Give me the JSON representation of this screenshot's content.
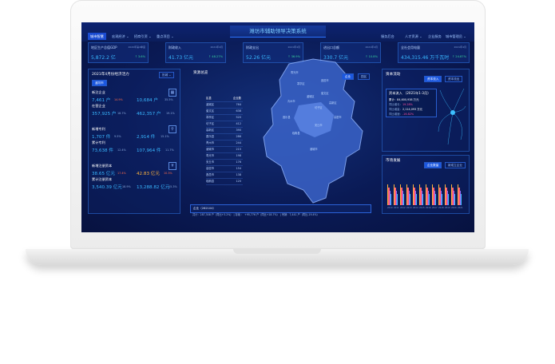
{
  "app": {
    "title": "潍坊市辅助领导决策系统"
  },
  "nav_left": [
    {
      "label": "城市智慧",
      "active": true
    },
    {
      "label": "宏观经济 ⌄",
      "active": false
    },
    {
      "label": "招商引资 ⌄",
      "active": false
    },
    {
      "label": "重点项目 ⌄",
      "active": false
    }
  ],
  "nav_right": [
    "服务后台",
    "人才资源 ⌄",
    "企业服务",
    "城市管理员 ⌄"
  ],
  "cards": [
    {
      "label": "地区生产总值GDP",
      "date": "2020年第4季度",
      "value": "5,872.2 亿",
      "change": "↑ 3.6%"
    },
    {
      "label": "财政收入",
      "date": "2021年4月",
      "value": "41.73 亿元",
      "change": "↑ 48.27%"
    },
    {
      "label": "财政支出",
      "date": "2021年4月",
      "value": "52.26 亿元",
      "change": "↑ 36.9%"
    },
    {
      "label": "进出口总额",
      "date": "2021年4月",
      "value": "330.7 亿元",
      "change": "↑ 10.8%"
    },
    {
      "label": "全社会用电量",
      "date": "2021年4月",
      "value": "434,315.46 万千瓦时",
      "change": "↑ 24.87%"
    }
  ],
  "left_panel": {
    "title": "2021年4月份经济活力",
    "dropdown": "历城 ⌄",
    "subtab": "潍坊市",
    "sections": [
      {
        "title": "新注企业",
        "a": "7,461 户",
        "a_chg": "14.9%",
        "b": "10,684 户",
        "b_chg": "35.5%"
      },
      {
        "title": "在营企业",
        "a": "357,925 户",
        "a_chg": "18.7%",
        "b": "462,357 户",
        "b_chg": "19.1%"
      },
      {
        "title": "新增专利",
        "a": "1,707 件",
        "a_chg": "9.5%",
        "b": "2,914 件",
        "b_chg": "15.1%"
      },
      {
        "title": "累计专利",
        "a": "73,638 件",
        "a_chg": "12.4%",
        "b": "107,964 件",
        "b_chg": "11.7%"
      },
      {
        "title": "新增注册资本",
        "a": "38.65 亿元",
        "a_chg": "17.4%",
        "b": "42.83 亿元",
        "b_chg": "10.3%"
      },
      {
        "title": "累计注册资本",
        "a": "3,540.39 亿元",
        "a_chg": "18.9%",
        "b": "13,288.82 亿元",
        "b_chg": "15.3%"
      }
    ]
  },
  "table": {
    "title": "资源总览",
    "headers": [
      "区县",
      "企业数"
    ],
    "rows": [
      [
        "潍城区",
        "764"
      ],
      [
        "奎文区",
        "638"
      ],
      [
        "寒亭区",
        "520"
      ],
      [
        "坊子区",
        "412"
      ],
      [
        "高新区",
        "390"
      ],
      [
        "昌乐县",
        "286"
      ],
      [
        "青州市",
        "244"
      ],
      [
        "诸城市",
        "215"
      ],
      [
        "寿光市",
        "198"
      ],
      [
        "安丘市",
        "176"
      ],
      [
        "高密市",
        "154"
      ],
      [
        "昌邑市",
        "138"
      ],
      [
        "临朐县",
        "120"
      ]
    ]
  },
  "map": {
    "toggles": [
      "企业",
      "园区"
    ],
    "labels": [
      "寿光市",
      "寒亭区",
      "昌邑市",
      "青州市",
      "潍城区",
      "奎文区",
      "坊子区",
      "高新区",
      "昌乐县",
      "临朐县",
      "安丘市",
      "高密市",
      "诸城市"
    ],
    "footer": "企业（282104）",
    "footer2": "共计：287,308 户（同比+3.2%）  | 存续 ： +95,776 户（同比+18.7%）  | 吊销：7,441 户（同比-19.4%）"
  },
  "right_top": {
    "title": "资本流动",
    "tabs": [
      "资本流入",
      "资本流出"
    ],
    "headline": "资本流入 （2021年1-3月）",
    "lines": [
      {
        "label": "累计：",
        "value": "84,600,938 万元"
      },
      {
        "label": "同比增长：",
        "value": "19.28%"
      },
      {
        "label": "同比增量：",
        "value": "2,114,093 万元"
      },
      {
        "label": "同比增速：",
        "value": "-16.82%"
      }
    ]
  },
  "right_bottom": {
    "title": "市场发展",
    "tabs": [
      "企业数量",
      "新成立企业"
    ],
    "years": [
      "2010",
      "2011",
      "2012",
      "2013",
      "2014",
      "2015",
      "2016",
      "2017",
      "2018",
      "2019",
      "2020",
      "2021"
    ]
  }
}
